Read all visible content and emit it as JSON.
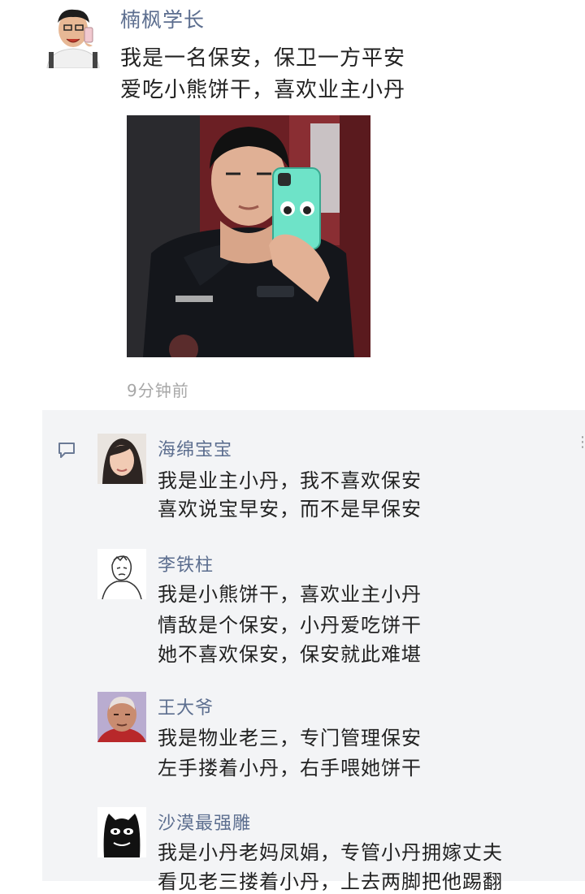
{
  "post": {
    "author": "楠枫学长",
    "lines": [
      "我是一名保安，保卫一方平安",
      "爱吃小熊饼干，喜欢业主小丹"
    ],
    "timestamp": "9分钟前"
  },
  "comments": [
    {
      "name": "海绵宝宝",
      "lines": [
        "我是业主小丹，我不喜欢保安",
        "喜欢说宝早安，而不是早保安"
      ]
    },
    {
      "name": "李铁柱",
      "lines": [
        "我是小熊饼干，喜欢业主小丹",
        "情敌是个保安，小丹爱吃饼干",
        "她不喜欢保安，保安就此难堪"
      ]
    },
    {
      "name": "王大爷",
      "lines": [
        "我是物业老三，专门管理保安",
        "左手搂着小丹，右手喂她饼干"
      ]
    },
    {
      "name": "沙漠最强雕",
      "lines": [
        "我是小丹老妈凤娟，专管小丹拥嫁丈夫",
        "看见老三搂着小丹，上去两脚把他踢翻"
      ]
    }
  ],
  "icons": {
    "comment": "comment-bubble-icon",
    "more": "more-dots-icon"
  }
}
